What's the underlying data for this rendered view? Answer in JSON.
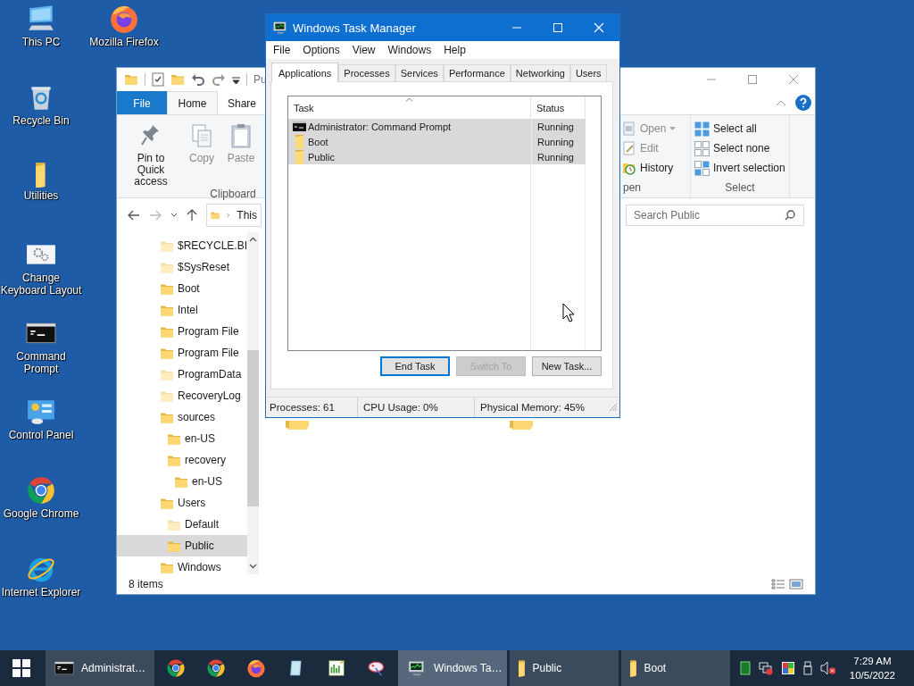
{
  "desktop_icons": [
    {
      "label": "This PC",
      "kind": "pc"
    },
    {
      "label": "Recycle Bin",
      "kind": "recycle"
    },
    {
      "label": "Utilities",
      "kind": "folder"
    },
    {
      "label": "Change Keyboard Layout",
      "kind": "settings"
    },
    {
      "label": "Command Prompt",
      "kind": "console"
    },
    {
      "label": "Control Panel",
      "kind": "control"
    },
    {
      "label": "Google Chrome",
      "kind": "chrome"
    },
    {
      "label": "Internet Explorer",
      "kind": "ie"
    },
    {
      "label": "Mozilla Firefox",
      "kind": "firefox"
    }
  ],
  "explorer": {
    "title": "Pu",
    "ribbon_tabs": [
      {
        "label": "File",
        "kind": "file",
        "selected": false
      },
      {
        "label": "Home",
        "kind": "tab",
        "selected": true
      },
      {
        "label": "Share",
        "kind": "tab",
        "selected": false
      }
    ],
    "clipboard": {
      "label": "Clipboard",
      "commands": [
        {
          "label": "Pin to Quick access",
          "kind": "pin",
          "disabled": false
        },
        {
          "label": "Copy",
          "kind": "copy",
          "disabled": true
        },
        {
          "label": "Paste",
          "kind": "paste",
          "disabled": true
        }
      ]
    },
    "open": {
      "label": "pen",
      "commands": [
        {
          "label": "Open",
          "kind": "open",
          "disabled": true,
          "dropdown": true
        },
        {
          "label": "Edit",
          "kind": "edit",
          "disabled": true,
          "dropdown": false
        },
        {
          "label": "History",
          "kind": "history",
          "disabled": false,
          "dropdown": false
        }
      ]
    },
    "select": {
      "label": "Select",
      "commands": [
        {
          "label": "Select all",
          "kind": "all"
        },
        {
          "label": "Select none",
          "kind": "none"
        },
        {
          "label": "Invert selection",
          "kind": "invert"
        }
      ]
    },
    "address": "This",
    "search": {
      "placeholder": "Search Public"
    },
    "tree": [
      {
        "label": "$RECYCLE.BI",
        "hidden": true,
        "selected": false
      },
      {
        "label": "$SysReset",
        "hidden": true,
        "selected": false
      },
      {
        "label": "Boot",
        "hidden": false,
        "selected": false
      },
      {
        "label": "Intel",
        "hidden": false,
        "selected": false
      },
      {
        "label": "Program File",
        "hidden": false,
        "selected": false
      },
      {
        "label": "Program File",
        "hidden": false,
        "selected": false
      },
      {
        "label": "ProgramData",
        "hidden": true,
        "selected": false
      },
      {
        "label": "RecoveryLog",
        "hidden": true,
        "selected": false
      },
      {
        "label": "sources",
        "hidden": false,
        "selected": false,
        "children": [
          {
            "label": "en-US",
            "hidden": false,
            "selected": false
          },
          {
            "label": "recovery",
            "hidden": false,
            "selected": false,
            "children": [
              {
                "label": "en-US",
                "hidden": false,
                "selected": false
              }
            ]
          }
        ]
      },
      {
        "label": "Users",
        "hidden": false,
        "selected": false,
        "children": [
          {
            "label": "Default",
            "hidden": true,
            "selected": false
          },
          {
            "label": "Public",
            "hidden": false,
            "selected": true
          }
        ]
      },
      {
        "label": "Windows",
        "hidden": false,
        "selected": false
      }
    ],
    "status": "8 items"
  },
  "task_manager": {
    "title": "Windows Task Manager",
    "menu": [
      "File",
      "Options",
      "View",
      "Windows",
      "Help"
    ],
    "tabs": [
      {
        "label": "Applications",
        "selected": true
      },
      {
        "label": "Processes",
        "selected": false
      },
      {
        "label": "Services",
        "selected": false
      },
      {
        "label": "Performance",
        "selected": false
      },
      {
        "label": "Networking",
        "selected": false
      },
      {
        "label": "Users",
        "selected": false
      }
    ],
    "columns": [
      "Task",
      "Status"
    ],
    "rows": [
      {
        "task": "Administrator: Command Prompt",
        "status": "Running",
        "kind": "console",
        "selected": true
      },
      {
        "task": "Boot",
        "status": "Running",
        "kind": "folder",
        "selected": true
      },
      {
        "task": "Public",
        "status": "Running",
        "kind": "folder",
        "selected": true
      }
    ],
    "buttons": [
      {
        "label": "End Task",
        "default": true,
        "disabled": false
      },
      {
        "label": "Switch To",
        "default": false,
        "disabled": true
      },
      {
        "label": "New Task...",
        "default": false,
        "disabled": false
      }
    ],
    "status_bar": [
      "Processes: 61",
      "CPU Usage: 0%",
      "Physical Memory: 45%"
    ]
  },
  "taskbar": {
    "items": [
      {
        "kind": "console",
        "label": "Administrat…",
        "open": true,
        "active": false
      },
      {
        "kind": "chrome",
        "open": false,
        "active": false
      },
      {
        "kind": "chrome",
        "open": false,
        "active": false
      },
      {
        "kind": "firefox",
        "open": false,
        "active": false
      },
      {
        "kind": "notepad",
        "open": false,
        "active": false
      },
      {
        "kind": "chart",
        "open": false,
        "active": false
      },
      {
        "kind": "paint",
        "open": false,
        "active": false
      },
      {
        "kind": "taskmgr",
        "label": "Windows Ta…",
        "open": true,
        "active": true
      },
      {
        "kind": "folder",
        "label": "Public",
        "open": true,
        "active": false
      },
      {
        "kind": "folder",
        "label": "Boot",
        "open": true,
        "active": false
      }
    ],
    "time": "7:29 AM",
    "date": "10/5/2022"
  }
}
